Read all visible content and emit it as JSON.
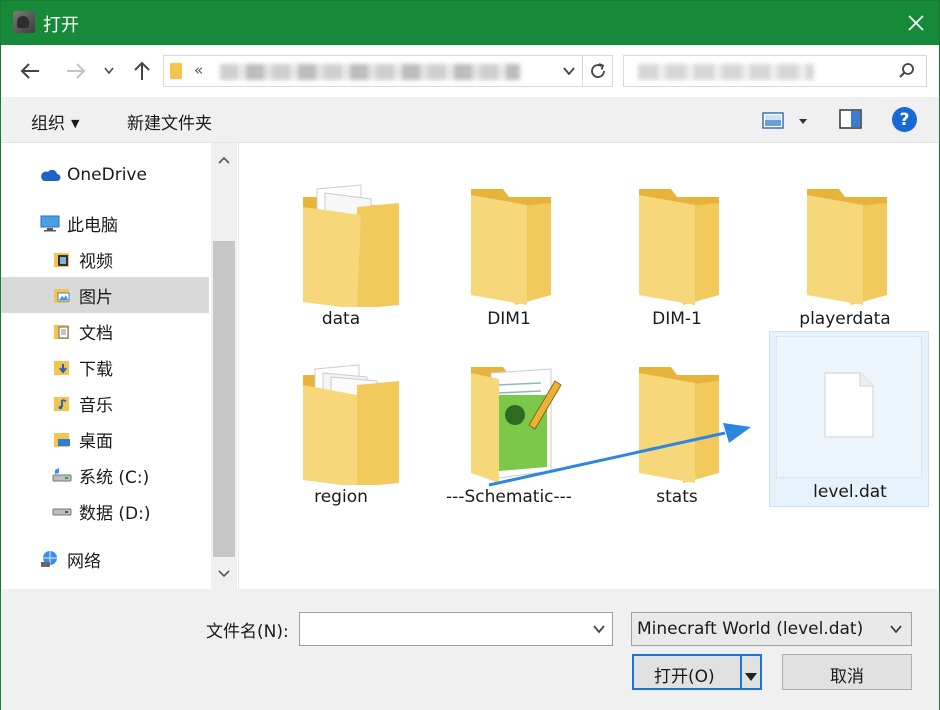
{
  "window": {
    "title": "打开"
  },
  "toolbar": {
    "organize_label": "组织",
    "new_folder_label": "新建文件夹",
    "help_label": "?"
  },
  "address": {
    "prefix": "«"
  },
  "sidebar": {
    "items": [
      {
        "label": "OneDrive",
        "icon": "cloud-icon"
      },
      {
        "label": "此电脑",
        "icon": "computer-icon"
      },
      {
        "label": "视频",
        "icon": "video-folder-icon"
      },
      {
        "label": "图片",
        "icon": "pictures-folder-icon"
      },
      {
        "label": "文档",
        "icon": "documents-folder-icon"
      },
      {
        "label": "下载",
        "icon": "downloads-folder-icon"
      },
      {
        "label": "音乐",
        "icon": "music-folder-icon"
      },
      {
        "label": "桌面",
        "icon": "desktop-folder-icon"
      },
      {
        "label": "系统 (C:)",
        "icon": "drive-c-icon"
      },
      {
        "label": "数据 (D:)",
        "icon": "drive-d-icon"
      },
      {
        "label": "网络",
        "icon": "network-icon"
      }
    ]
  },
  "files": [
    {
      "name": "data",
      "type": "folder-with-docs"
    },
    {
      "name": "DIM1",
      "type": "folder"
    },
    {
      "name": "DIM-1",
      "type": "folder"
    },
    {
      "name": "playerdata",
      "type": "folder"
    },
    {
      "name": "region",
      "type": "folder-with-docs"
    },
    {
      "name": "---Schematic---",
      "type": "folder-with-notepad"
    },
    {
      "name": "stats",
      "type": "folder"
    },
    {
      "name": "level.dat",
      "type": "file"
    }
  ],
  "bottom": {
    "filename_label": "文件名(N):",
    "filename_value": "",
    "filter_value": "Minecraft World (level.dat)",
    "open_label": "打开(O)",
    "cancel_label": "取消"
  },
  "colors": {
    "titlebar": "#178a3a",
    "folder": "#f4c44c",
    "accent": "#1a73d6",
    "annotation_arrow": "#2e86de"
  }
}
